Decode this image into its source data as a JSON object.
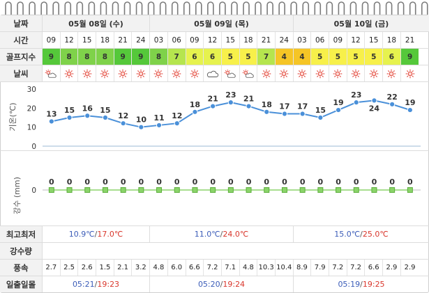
{
  "labels": {
    "date": "날짜",
    "time": "시간",
    "golf": "골프지수",
    "weather": "날씨",
    "temp_axis": "기온(℃)",
    "rain_axis": "강수 (mm)",
    "minmax": "최고최저",
    "rain": "강수량",
    "wind": "풍속",
    "sun": "일출일몰"
  },
  "days": [
    {
      "label": "05월 08일 (수)",
      "minmax": {
        "low": "10.9℃",
        "sep": "/",
        "high": "17.0℃"
      },
      "sun": {
        "rise": "05:21",
        "sep": "/",
        "set": "19:23"
      }
    },
    {
      "label": "05월 09일 (목)",
      "minmax": {
        "low": "11.0℃",
        "sep": "/",
        "high": "24.0℃"
      },
      "sun": {
        "rise": "05:20",
        "sep": "/",
        "set": "19:24"
      }
    },
    {
      "label": "05월 10일 (금)",
      "minmax": {
        "low": "15.0℃",
        "sep": "/",
        "high": "25.0℃"
      },
      "sun": {
        "rise": "05:19",
        "sep": "/",
        "set": "19:25"
      }
    }
  ],
  "times": [
    "09",
    "12",
    "15",
    "18",
    "21",
    "24",
    "03",
    "06",
    "09",
    "12",
    "15",
    "18",
    "21",
    "24",
    "03",
    "06",
    "09",
    "12",
    "15",
    "18",
    "21"
  ],
  "golf_index": [
    "9",
    "8",
    "8",
    "8",
    "9",
    "9",
    "8",
    "7",
    "6",
    "6",
    "5",
    "5",
    "7",
    "4",
    "4",
    "5",
    "5",
    "5",
    "5",
    "6",
    "9",
    "9"
  ],
  "golf_colors": {
    "9": "#55c83a",
    "8": "#7fd24a",
    "7": "#b5e54e",
    "6": "#e6f24e",
    "5": "#f7f04a",
    "4": "#f5c526"
  },
  "weather_icons": [
    "sun-cloud-icon",
    "sun-icon",
    "sun-icon",
    "sun-icon",
    "sun-icon",
    "sun-icon",
    "sun-icon",
    "sun-icon",
    "sun-icon",
    "cloud-icon",
    "sun-cloud-icon",
    "sun-cloud-icon",
    "sun-icon",
    "sun-icon",
    "sun-icon",
    "sun-icon",
    "sun-icon",
    "sun-icon",
    "sun-icon",
    "sun-icon",
    "sun-icon",
    "sun-icon"
  ],
  "wind": [
    "2.7",
    "2.5",
    "2.6",
    "1.5",
    "2.1",
    "3.2",
    "4.8",
    "6.0",
    "6.6",
    "7.2",
    "7.1",
    "4.8",
    "10.3",
    "10.4",
    "8.9",
    "7.9",
    "7.2",
    "7.2",
    "6.6",
    "2.9",
    "2.9"
  ],
  "chart_data": [
    {
      "type": "line",
      "ylabel": "기온(℃)",
      "yticks": [
        "30",
        "20",
        "10",
        "0"
      ],
      "ylim": [
        0,
        30
      ],
      "x": [
        "09",
        "12",
        "15",
        "18",
        "21",
        "24",
        "03",
        "06",
        "09",
        "12",
        "15",
        "18",
        "21",
        "24",
        "03",
        "06",
        "09",
        "12",
        "15",
        "18",
        "21"
      ],
      "series": [
        {
          "values": [
            13,
            15,
            16,
            15,
            12,
            10,
            11,
            12,
            18,
            21,
            23,
            21,
            18,
            17,
            17,
            15,
            19,
            23,
            24,
            22,
            19
          ]
        }
      ],
      "data_labels": [
        "13",
        "15",
        "16",
        "15",
        "12",
        "10",
        "11",
        "12",
        "18",
        "21",
        "23",
        "21",
        "18",
        "17",
        "17",
        "15",
        "19",
        "23",
        "24",
        "22",
        "19"
      ],
      "color": "#4a90d9",
      "grid": false
    },
    {
      "type": "line",
      "ylabel": "강수 (mm)",
      "yticks": [
        "0"
      ],
      "x": [
        "09",
        "12",
        "15",
        "18",
        "21",
        "24",
        "03",
        "06",
        "09",
        "12",
        "15",
        "18",
        "21",
        "24",
        "03",
        "06",
        "09",
        "12",
        "15",
        "18",
        "21"
      ],
      "series": [
        {
          "values": [
            0,
            0,
            0,
            0,
            0,
            0,
            0,
            0,
            0,
            0,
            0,
            0,
            0,
            0,
            0,
            0,
            0,
            0,
            0,
            0,
            0
          ]
        }
      ],
      "data_labels": [
        "0",
        "0",
        "0",
        "0",
        "0",
        "0",
        "0",
        "0",
        "0",
        "0",
        "0",
        "0",
        "0",
        "0",
        "0",
        "0",
        "0",
        "0",
        "0",
        "0",
        "0"
      ],
      "color": "#8bd46a",
      "grid": false
    }
  ]
}
